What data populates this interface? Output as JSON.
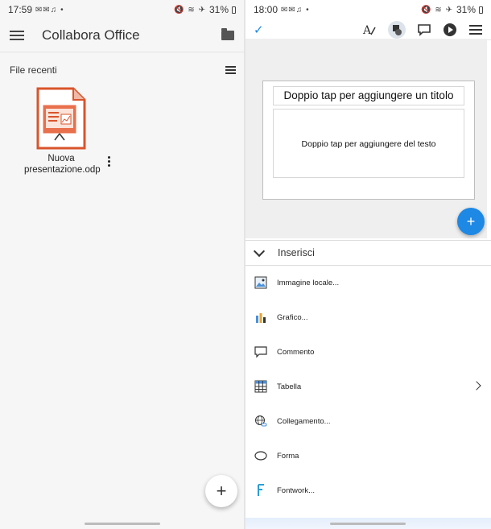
{
  "left": {
    "status": {
      "time": "17:59",
      "battery": "31%"
    },
    "app_title": "Collabora Office",
    "section_label": "File recenti",
    "file": {
      "name_line1": "Nuova",
      "name_line2": "presentazione.odp"
    },
    "fab_label": "+"
  },
  "right": {
    "status": {
      "time": "18:00",
      "battery": "31%"
    },
    "check_label": "✓",
    "slide": {
      "title_placeholder": "Doppio tap per aggiungere un titolo",
      "text_placeholder": "Doppio tap per aggiungere del testo"
    },
    "fab_label": "+",
    "insert": {
      "header": "Inserisci",
      "items": [
        {
          "label": "Immagine locale...",
          "icon": "image-icon"
        },
        {
          "label": "Grafico...",
          "icon": "chart-icon"
        },
        {
          "label": "Commento",
          "icon": "comment-icon"
        },
        {
          "label": "Tabella",
          "icon": "table-icon"
        },
        {
          "label": "Collegamento...",
          "icon": "link-icon"
        },
        {
          "label": "Forma",
          "icon": "shape-icon"
        },
        {
          "label": "Fontwork...",
          "icon": "fontwork-icon"
        }
      ]
    }
  },
  "colors": {
    "accent": "#1e88e5",
    "impress_orange": "#d9542b"
  }
}
